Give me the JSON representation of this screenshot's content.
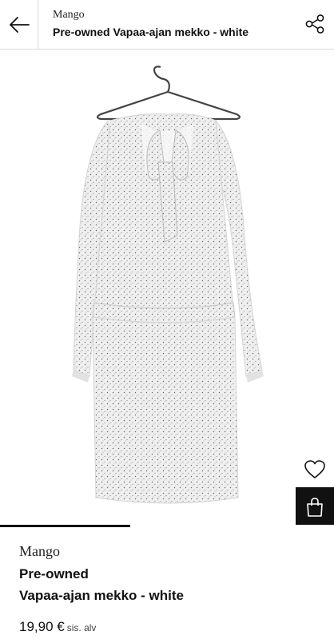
{
  "header": {
    "brand": "Mango",
    "title": "Pre-owned Vapaa-ajan mekko - white",
    "back_icon": "arrow-left-icon",
    "share_icon": "share-icon"
  },
  "gallery": {
    "image_subject": "white patterned dress on hanger",
    "progress": 0.39,
    "favorite_icon": "heart-icon",
    "cart_icon": "shopping-bag-icon"
  },
  "product": {
    "brand": "Mango",
    "condition": "Pre-owned",
    "name": "Vapaa-ajan mekko - white",
    "price": "19,90 €",
    "vat_note": "sis. alv"
  },
  "colors": {
    "accent": "#111111",
    "border": "#d9d9d9",
    "dress": "#eeeeee"
  }
}
